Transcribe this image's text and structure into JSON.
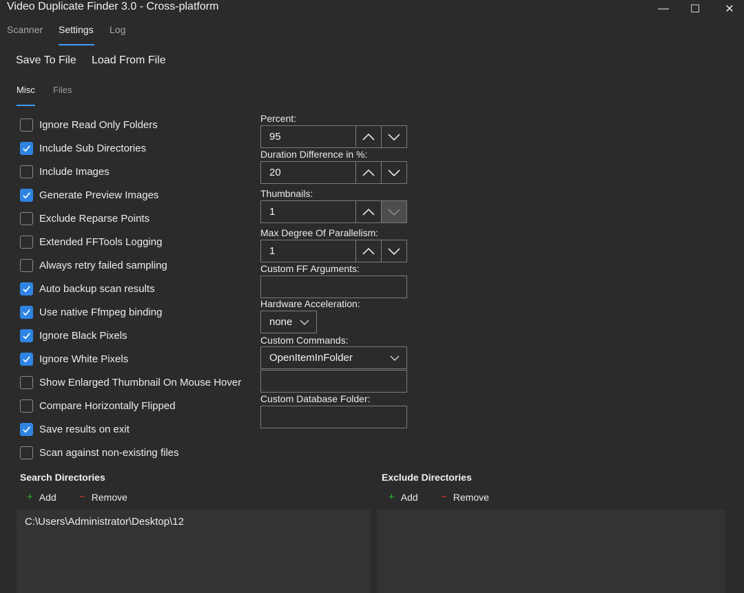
{
  "window": {
    "title": "Video Duplicate Finder 3.0 - Cross-platform",
    "minimize_glyph": "—",
    "maximize_glyph": "☐",
    "close_glyph": "✕"
  },
  "tabs": [
    {
      "label": "Scanner"
    },
    {
      "label": "Settings",
      "active": true
    },
    {
      "label": "Log"
    }
  ],
  "actions": {
    "save_label": "Save To File",
    "load_label": "Load From File"
  },
  "subtabs": [
    {
      "label": "Misc",
      "active": true
    },
    {
      "label": "Files"
    }
  ],
  "checkboxes": [
    {
      "label": "Ignore Read Only Folders",
      "checked": false
    },
    {
      "label": "Include Sub Directories",
      "checked": true
    },
    {
      "label": "Include Images",
      "checked": false
    },
    {
      "label": "Generate Preview Images",
      "checked": true
    },
    {
      "label": "Exclude Reparse Points",
      "checked": false
    },
    {
      "label": "Extended FFTools Logging",
      "checked": false
    },
    {
      "label": "Always retry failed sampling",
      "checked": false
    },
    {
      "label": "Auto backup scan results",
      "checked": true
    },
    {
      "label": "Use native Ffmpeg binding",
      "checked": true
    },
    {
      "label": "Ignore Black Pixels",
      "checked": true
    },
    {
      "label": "Ignore White Pixels",
      "checked": true
    },
    {
      "label": "Show Enlarged Thumbnail On Mouse Hover",
      "checked": false
    },
    {
      "label": "Compare Horizontally Flipped",
      "checked": false
    },
    {
      "label": "Save results on exit",
      "checked": true
    },
    {
      "label": "Scan against non-existing files",
      "checked": false
    }
  ],
  "fields": {
    "percent": {
      "label": "Percent:",
      "value": "95"
    },
    "duration": {
      "label": "Duration Difference in %:",
      "value": "20"
    },
    "thumbnails": {
      "label": "Thumbnails:",
      "value": "1"
    },
    "parallelism": {
      "label": "Max Degree Of Parallelism:",
      "value": "1"
    },
    "ff_arguments": {
      "label": "Custom FF Arguments:",
      "value": ""
    },
    "hw_accel": {
      "label": "Hardware Acceleration:",
      "value": "none"
    },
    "custom_commands": {
      "label": "Custom Commands:",
      "value": "OpenItemInFolder",
      "extra_value": ""
    },
    "database_folder": {
      "label": "Custom Database Folder:",
      "value": ""
    }
  },
  "search": {
    "heading": "Search Directories",
    "add_label": "Add",
    "remove_label": "Remove",
    "items": [
      "C:\\Users\\Administrator\\Desktop\\12"
    ]
  },
  "exclude": {
    "heading": "Exclude Directories",
    "add_label": "Add",
    "remove_label": "Remove"
  },
  "colors": {
    "accent": "#2e84e3",
    "add": "#2eb82e",
    "remove": "#e03434",
    "background": "#2b2b2b"
  }
}
